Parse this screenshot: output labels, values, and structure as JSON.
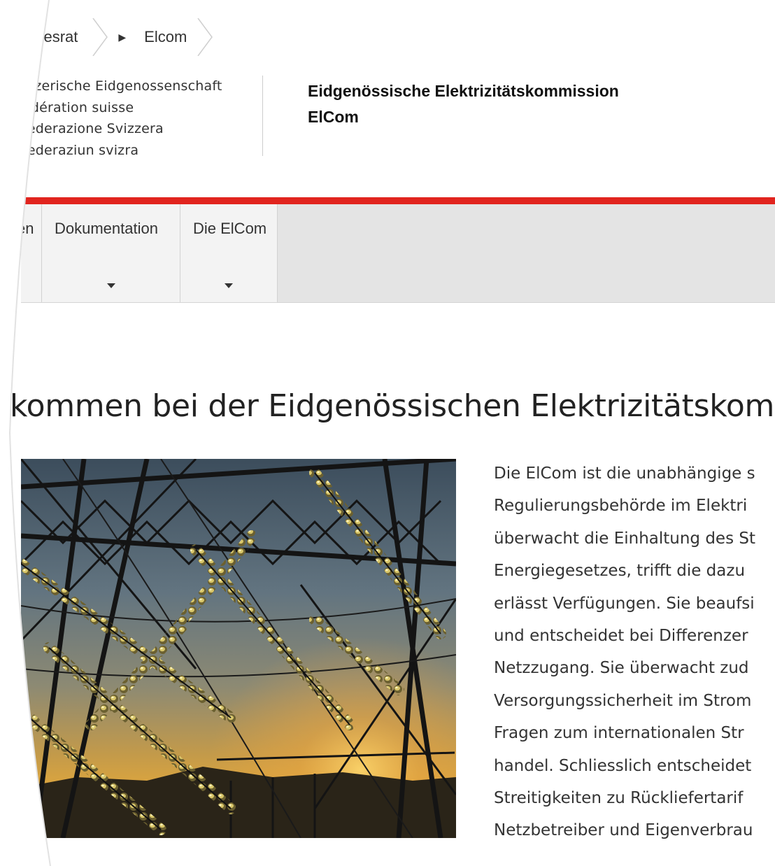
{
  "breadcrumb": {
    "items": [
      {
        "label": "ndesrat"
      },
      {
        "label": "Elcom"
      }
    ]
  },
  "logo": {
    "lines": [
      "eizerische Eidgenossenschaft",
      "édération suisse",
      "federazione Svizzera",
      "federaziun svizra"
    ]
  },
  "org": {
    "name_line1": "Eidgenössische Elektrizitätskommission",
    "name_line2": "ElCom"
  },
  "nav": {
    "items": [
      {
        "label": "en"
      },
      {
        "label": "Dokumentation"
      },
      {
        "label": "Die ElCom"
      }
    ]
  },
  "main": {
    "headline": "kommen bei der Eidgenössischen Elektrizitätskommissio",
    "body_lines": [
      "Die ElCom ist die unabhängige s",
      "Regulierungsbehörde im Elektri",
      "überwacht die Einhaltung des St",
      "Energiegesetzes, trifft die dazu",
      "erlässt Verfügungen. Sie beaufsi",
      "und entscheidet bei Differenzer",
      "Netzzugang. Sie überwacht zud",
      "Versorgungssicherheit im Strom",
      "Fragen zum internationalen Str",
      "handel. Schliesslich entscheidet",
      "Streitigkeiten zu Rückliefertarif",
      "Netzbetreiber und Eigenverbrau"
    ]
  },
  "colors": {
    "accent_red": "#e1241e",
    "nav_bg": "#e4e4e4",
    "nav_item_bg": "#f3f3f3"
  }
}
